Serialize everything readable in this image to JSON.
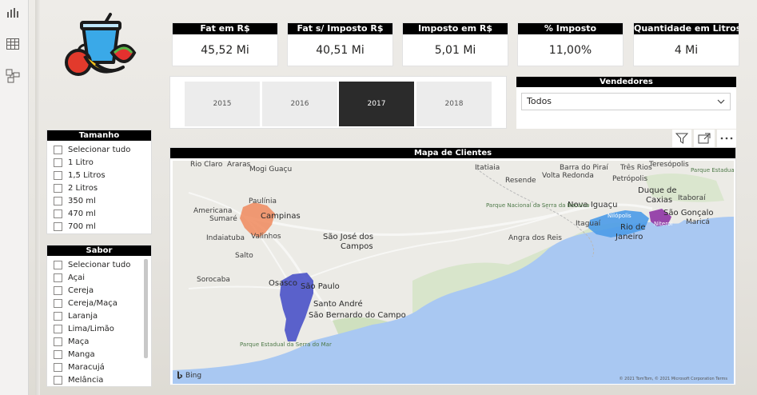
{
  "left_rail": {
    "icons": [
      "report-view-icon",
      "table-view-icon",
      "model-view-icon"
    ]
  },
  "kpis": [
    {
      "title": "Fat em R$",
      "value": "45,52 Mi"
    },
    {
      "title": "Fat s/ Imposto R$",
      "value": "40,51 Mi"
    },
    {
      "title": "Imposto em R$",
      "value": "5,01 Mi"
    },
    {
      "title": "% Imposto",
      "value": "11,00%"
    },
    {
      "title": "Quantidade em Litros",
      "value": "4 Mi"
    }
  ],
  "years": {
    "items": [
      "2015",
      "2016",
      "2017",
      "2018"
    ],
    "selected": "2017"
  },
  "vendedores": {
    "title": "Vendedores",
    "selected": "Todos"
  },
  "tamanho": {
    "title": "Tamanho",
    "items": [
      "Selecionar tudo",
      "1 Litro",
      "1,5 Litros",
      "2 Litros",
      "350 ml",
      "470 ml",
      "700 ml"
    ]
  },
  "sabor": {
    "title": "Sabor",
    "items": [
      "Selecionar tudo",
      "Açai",
      "Cereja",
      "Cereja/Maça",
      "Laranja",
      "Lima/Limão",
      "Maça",
      "Manga",
      "Maracujá",
      "Melância"
    ]
  },
  "map": {
    "title": "Mapa de Clientes",
    "bing_label": "Bing",
    "copyright": "© 2021 TomTom, © 2021 Microsoft Corporation  Terms",
    "cities": {
      "rio_claro": "Rio Claro",
      "araras": "Araras",
      "mogi_guacu": "Mogi Guaçu",
      "americana": "Americana",
      "paulinia": "Paulínia",
      "sumare": "Sumaré",
      "campinas": "Campinas",
      "indaiatuba": "Indaiatuba",
      "valinhos": "Valinhos",
      "salto": "Salto",
      "sao_jose": "São José dos",
      "campos": "Campos",
      "sorocaba": "Sorocaba",
      "osasco": "Osasco",
      "sao_paulo": "São Paulo",
      "santo_andre": "Santo André",
      "sao_bernardo": "São Bernardo do Campo",
      "barra_do_pirai": "Barra do Piraí",
      "itatiaia": "Itatiaia",
      "volta_redonda": "Volta Redonda",
      "resende": "Resende",
      "tres_rios": "Três Rios",
      "petropolis": "Petrópolis",
      "teresopolis": "Teresópolis",
      "duque": "Duque de",
      "caxias": "Caxias",
      "itaborai": "Itaboraí",
      "nova_iguacu": "Nova Iguaçu",
      "sao_goncalo": "São Gonçalo",
      "nilopolis": "Nilópolis",
      "itaguai": "Itaguaí",
      "rio": "Rio de",
      "janeiro": "Janeiro",
      "niteroi": "Niterói",
      "marica": "Maricá",
      "angra": "Angra dos Reis",
      "parque_bocaina": "Parque Nacional da Serra da Bocaina",
      "parque_serra": "Parque Estadual da Serra do Mar",
      "parque_tres_picos": "Parque Estadual dos Três Picos"
    }
  },
  "colors": {
    "campinas_region": "#f08a5d",
    "sao_paulo_region": "#4a52c8",
    "rio_region": "#4b9be8",
    "niteroi_region": "#8a2aa0",
    "ocean": "#a9c8f2",
    "land": "#ecebe6",
    "forest": "#c8dcb8"
  }
}
